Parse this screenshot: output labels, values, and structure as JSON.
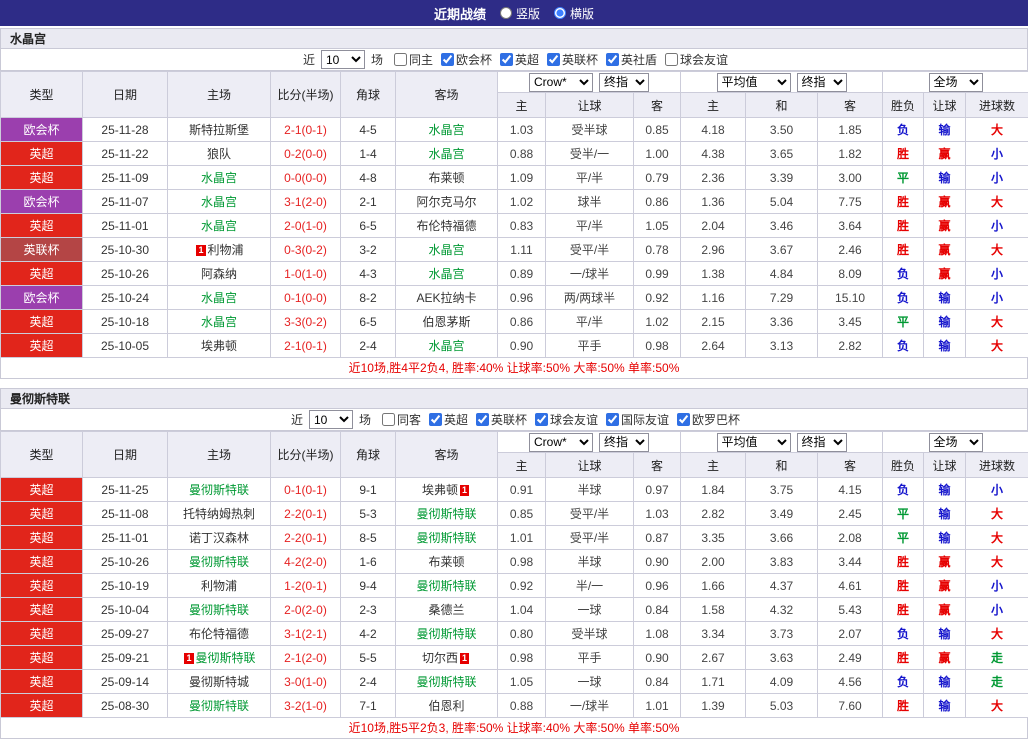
{
  "topbar": {
    "title": "近期战绩",
    "layout_options": [
      {
        "label": "竖版",
        "selected": false
      },
      {
        "label": "横版",
        "selected": true
      }
    ]
  },
  "table_header": {
    "left_cols": [
      "类型",
      "日期",
      "主场",
      "比分(半场)",
      "角球",
      "客场"
    ],
    "odds_source": "Crow*",
    "odds_time": "终指",
    "avg_label": "平均值",
    "avg_time": "终指",
    "scope": "全场",
    "odds_cols": [
      "主",
      "让球",
      "客"
    ],
    "avg_cols": [
      "主",
      "和",
      "客"
    ],
    "result_cols": [
      "胜负",
      "让球",
      "进球数"
    ]
  },
  "league_colors": {
    "英超": "#e1251b",
    "欧会杯": "#9b3fae",
    "英联杯": "#b44545"
  },
  "result_colors": {
    "胜": "#e60000",
    "负": "#1515cc",
    "平": "#009933",
    "赢": "#e60000",
    "输": "#1515cc",
    "走": "#009933",
    "大": "#e60000",
    "小": "#1515cc"
  },
  "team_highlight_color": "#009933",
  "sections": [
    {
      "team": "水晶宫",
      "filter": {
        "near_label": "近",
        "count": "10",
        "unit_label": "场",
        "checkboxes": [
          {
            "label": "同主",
            "checked": false
          },
          {
            "label": "欧会杯",
            "checked": true
          },
          {
            "label": "英超",
            "checked": true
          },
          {
            "label": "英联杯",
            "checked": true
          },
          {
            "label": "英社盾",
            "checked": true
          },
          {
            "label": "球会友谊",
            "checked": false
          }
        ]
      },
      "rows": [
        {
          "league": "欧会杯",
          "date": "25-11-28",
          "home": "斯特拉斯堡",
          "score": "2-1(0-1)",
          "corner": "4-5",
          "away": "水晶宫",
          "away_team": true,
          "o1": "1.03",
          "handicap": "受半球",
          "o2": "0.85",
          "a1": "4.18",
          "a2": "3.50",
          "a3": "1.85",
          "r1": "负",
          "r2": "输",
          "r3": "大"
        },
        {
          "league": "英超",
          "date": "25-11-22",
          "home": "狼队",
          "score": "0-2(0-0)",
          "corner": "1-4",
          "away": "水晶宫",
          "away_team": true,
          "o1": "0.88",
          "handicap": "受半/一",
          "o2": "1.00",
          "a1": "4.38",
          "a2": "3.65",
          "a3": "1.82",
          "r1": "胜",
          "r2": "赢",
          "r3": "小"
        },
        {
          "league": "英超",
          "date": "25-11-09",
          "home": "水晶宫",
          "home_team": true,
          "score": "0-0(0-0)",
          "corner": "4-8",
          "away": "布莱顿",
          "o1": "1.09",
          "handicap": "平/半",
          "o2": "0.79",
          "a1": "2.36",
          "a2": "3.39",
          "a3": "3.00",
          "r1": "平",
          "r2": "输",
          "r3": "小"
        },
        {
          "league": "欧会杯",
          "date": "25-11-07",
          "home": "水晶宫",
          "home_team": true,
          "score": "3-1(2-0)",
          "corner": "2-1",
          "away": "阿尔克马尔",
          "o1": "1.02",
          "handicap": "球半",
          "o2": "0.86",
          "a1": "1.36",
          "a2": "5.04",
          "a3": "7.75",
          "r1": "胜",
          "r2": "赢",
          "r3": "大"
        },
        {
          "league": "英超",
          "date": "25-11-01",
          "home": "水晶宫",
          "home_team": true,
          "score": "2-0(1-0)",
          "corner": "6-5",
          "away": "布伦特福德",
          "o1": "0.83",
          "handicap": "平/半",
          "o2": "1.05",
          "a1": "2.04",
          "a2": "3.46",
          "a3": "3.64",
          "r1": "胜",
          "r2": "赢",
          "r3": "小"
        },
        {
          "league": "英联杯",
          "date": "25-10-30",
          "home": "利物浦",
          "home_rc": "1",
          "home_rc_pos": "l",
          "score": "0-3(0-2)",
          "corner": "3-2",
          "away": "水晶宫",
          "away_team": true,
          "o1": "1.11",
          "handicap": "受平/半",
          "o2": "0.78",
          "a1": "2.96",
          "a2": "3.67",
          "a3": "2.46",
          "r1": "胜",
          "r2": "赢",
          "r3": "大"
        },
        {
          "league": "英超",
          "date": "25-10-26",
          "home": "阿森纳",
          "score": "1-0(1-0)",
          "corner": "4-3",
          "away": "水晶宫",
          "away_team": true,
          "o1": "0.89",
          "handicap": "一/球半",
          "o2": "0.99",
          "a1": "1.38",
          "a2": "4.84",
          "a3": "8.09",
          "r1": "负",
          "r2": "赢",
          "r3": "小"
        },
        {
          "league": "欧会杯",
          "date": "25-10-24",
          "home": "水晶宫",
          "home_team": true,
          "score": "0-1(0-0)",
          "corner": "8-2",
          "away": "AEK拉纳卡",
          "o1": "0.96",
          "handicap": "两/两球半",
          "o2": "0.92",
          "a1": "1.16",
          "a2": "7.29",
          "a3": "15.10",
          "r1": "负",
          "r2": "输",
          "r3": "小"
        },
        {
          "league": "英超",
          "date": "25-10-18",
          "home": "水晶宫",
          "home_team": true,
          "score": "3-3(0-2)",
          "corner": "6-5",
          "away": "伯恩茅斯",
          "o1": "0.86",
          "handicap": "平/半",
          "o2": "1.02",
          "a1": "2.15",
          "a2": "3.36",
          "a3": "3.45",
          "r1": "平",
          "r2": "输",
          "r3": "大"
        },
        {
          "league": "英超",
          "date": "25-10-05",
          "home": "埃弗顿",
          "score": "2-1(0-1)",
          "corner": "2-4",
          "away": "水晶宫",
          "away_team": true,
          "o1": "0.90",
          "handicap": "平手",
          "o2": "0.98",
          "a1": "2.64",
          "a2": "3.13",
          "a3": "2.82",
          "r1": "负",
          "r2": "输",
          "r3": "大"
        }
      ],
      "summary": "近10场,胜4平2负4, 胜率:40% 让球率:50% 大率:50% 单率:50%"
    },
    {
      "team": "曼彻斯特联",
      "filter": {
        "near_label": "近",
        "count": "10",
        "unit_label": "场",
        "checkboxes": [
          {
            "label": "同客",
            "checked": false
          },
          {
            "label": "英超",
            "checked": true
          },
          {
            "label": "英联杯",
            "checked": true
          },
          {
            "label": "球会友谊",
            "checked": true
          },
          {
            "label": "国际友谊",
            "checked": true
          },
          {
            "label": "欧罗巴杯",
            "checked": true
          }
        ]
      },
      "rows": [
        {
          "league": "英超",
          "date": "25-11-25",
          "home": "曼彻斯特联",
          "home_team": true,
          "score": "0-1(0-1)",
          "corner": "9-1",
          "away": "埃弗顿",
          "away_rc": "1",
          "away_rc_pos": "r",
          "o1": "0.91",
          "handicap": "半球",
          "o2": "0.97",
          "a1": "1.84",
          "a2": "3.75",
          "a3": "4.15",
          "r1": "负",
          "r2": "输",
          "r3": "小"
        },
        {
          "league": "英超",
          "date": "25-11-08",
          "home": "托特纳姆热刺",
          "score": "2-2(0-1)",
          "corner": "5-3",
          "away": "曼彻斯特联",
          "away_team": true,
          "o1": "0.85",
          "handicap": "受平/半",
          "o2": "1.03",
          "a1": "2.82",
          "a2": "3.49",
          "a3": "2.45",
          "r1": "平",
          "r2": "输",
          "r3": "大"
        },
        {
          "league": "英超",
          "date": "25-11-01",
          "home": "诺丁汉森林",
          "score": "2-2(0-1)",
          "corner": "8-5",
          "away": "曼彻斯特联",
          "away_team": true,
          "o1": "1.01",
          "handicap": "受平/半",
          "o2": "0.87",
          "a1": "3.35",
          "a2": "3.66",
          "a3": "2.08",
          "r1": "平",
          "r2": "输",
          "r3": "大"
        },
        {
          "league": "英超",
          "date": "25-10-26",
          "home": "曼彻斯特联",
          "home_team": true,
          "score": "4-2(2-0)",
          "corner": "1-6",
          "away": "布莱顿",
          "o1": "0.98",
          "handicap": "半球",
          "o2": "0.90",
          "a1": "2.00",
          "a2": "3.83",
          "a3": "3.44",
          "r1": "胜",
          "r2": "赢",
          "r3": "大"
        },
        {
          "league": "英超",
          "date": "25-10-19",
          "home": "利物浦",
          "score": "1-2(0-1)",
          "corner": "9-4",
          "away": "曼彻斯特联",
          "away_team": true,
          "o1": "0.92",
          "handicap": "半/一",
          "o2": "0.96",
          "a1": "1.66",
          "a2": "4.37",
          "a3": "4.61",
          "r1": "胜",
          "r2": "赢",
          "r3": "小"
        },
        {
          "league": "英超",
          "date": "25-10-04",
          "home": "曼彻斯特联",
          "home_team": true,
          "score": "2-0(2-0)",
          "corner": "2-3",
          "away": "桑德兰",
          "o1": "1.04",
          "handicap": "一球",
          "o2": "0.84",
          "a1": "1.58",
          "a2": "4.32",
          "a3": "5.43",
          "r1": "胜",
          "r2": "赢",
          "r3": "小"
        },
        {
          "league": "英超",
          "date": "25-09-27",
          "home": "布伦特福德",
          "score": "3-1(2-1)",
          "corner": "4-2",
          "away": "曼彻斯特联",
          "away_team": true,
          "o1": "0.80",
          "handicap": "受半球",
          "o2": "1.08",
          "a1": "3.34",
          "a2": "3.73",
          "a3": "2.07",
          "r1": "负",
          "r2": "输",
          "r3": "大"
        },
        {
          "league": "英超",
          "date": "25-09-21",
          "home": "曼彻斯特联",
          "home_team": true,
          "home_rc": "1",
          "home_rc_pos": "l",
          "score": "2-1(2-0)",
          "corner": "5-5",
          "away": "切尔西",
          "away_rc": "1",
          "away_rc_pos": "r",
          "o1": "0.98",
          "handicap": "平手",
          "o2": "0.90",
          "a1": "2.67",
          "a2": "3.63",
          "a3": "2.49",
          "r1": "胜",
          "r2": "赢",
          "r3": "走"
        },
        {
          "league": "英超",
          "date": "25-09-14",
          "home": "曼彻斯特城",
          "score": "3-0(1-0)",
          "corner": "2-4",
          "away": "曼彻斯特联",
          "away_team": true,
          "o1": "1.05",
          "handicap": "一球",
          "o2": "0.84",
          "a1": "1.71",
          "a2": "4.09",
          "a3": "4.56",
          "r1": "负",
          "r2": "输",
          "r3": "走"
        },
        {
          "league": "英超",
          "date": "25-08-30",
          "home": "曼彻斯特联",
          "home_team": true,
          "score": "3-2(1-0)",
          "corner": "7-1",
          "away": "伯恩利",
          "o1": "0.88",
          "handicap": "一/球半",
          "o2": "1.01",
          "a1": "1.39",
          "a2": "5.03",
          "a3": "7.60",
          "r1": "胜",
          "r2": "输",
          "r3": "大"
        }
      ],
      "summary": "近10场,胜5平2负3, 胜率:50% 让球率:40% 大率:50% 单率:50%"
    }
  ]
}
